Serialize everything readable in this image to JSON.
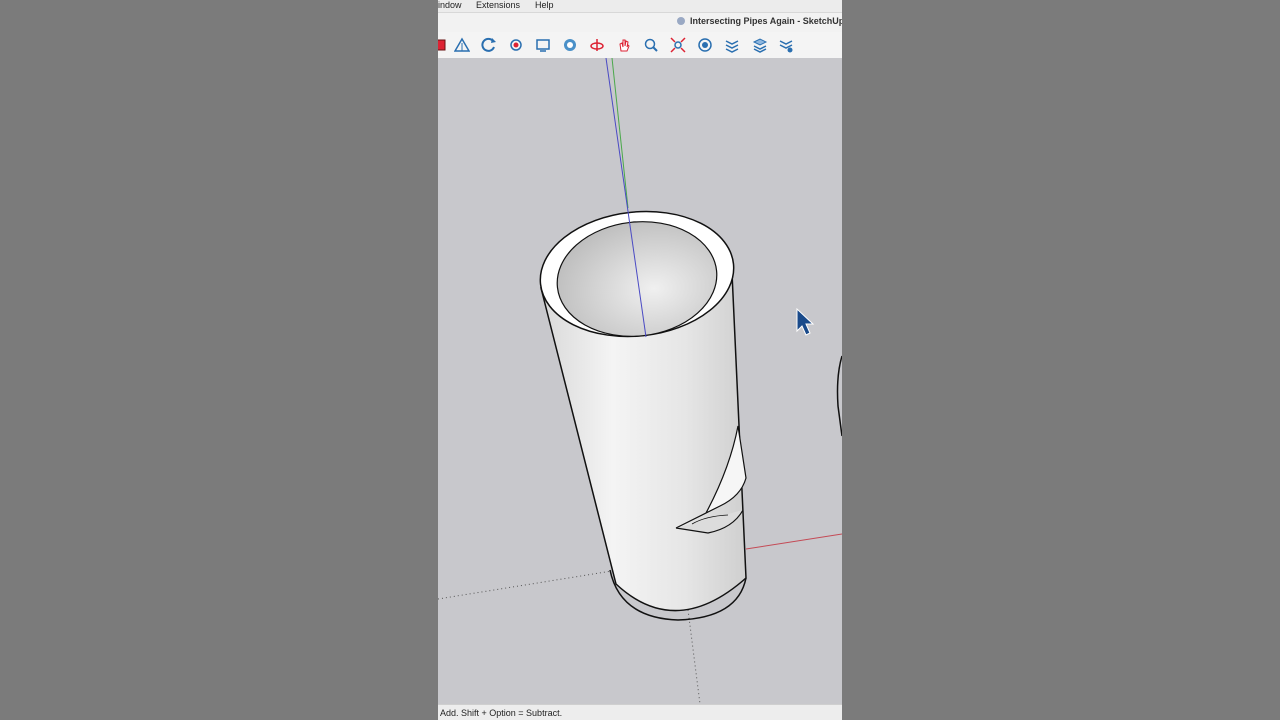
{
  "menu": {
    "items": [
      "indow",
      "Extensions",
      "Help"
    ]
  },
  "window": {
    "title": "Intersecting Pipes Again - SketchUp"
  },
  "toolbar": {
    "tools": [
      "paint-bucket-icon",
      "triangle-icon",
      "orbit-icon",
      "position-camera-icon",
      "look-around-icon",
      "walk-icon",
      "section-plane-icon",
      "pan-icon",
      "zoom-icon",
      "zoom-extents-icon",
      "solid-tools-icon",
      "intersect-icon",
      "layers-icon",
      "subtract-icon"
    ]
  },
  "status": {
    "text": "Add. Shift + Option = Subtract."
  },
  "colors": {
    "x_axis": "#c44a55",
    "y_axis": "#4aa84a",
    "z_axis": "#4a4ac4",
    "background": "#c8c8cc",
    "pipe": "#e9e9e9"
  }
}
